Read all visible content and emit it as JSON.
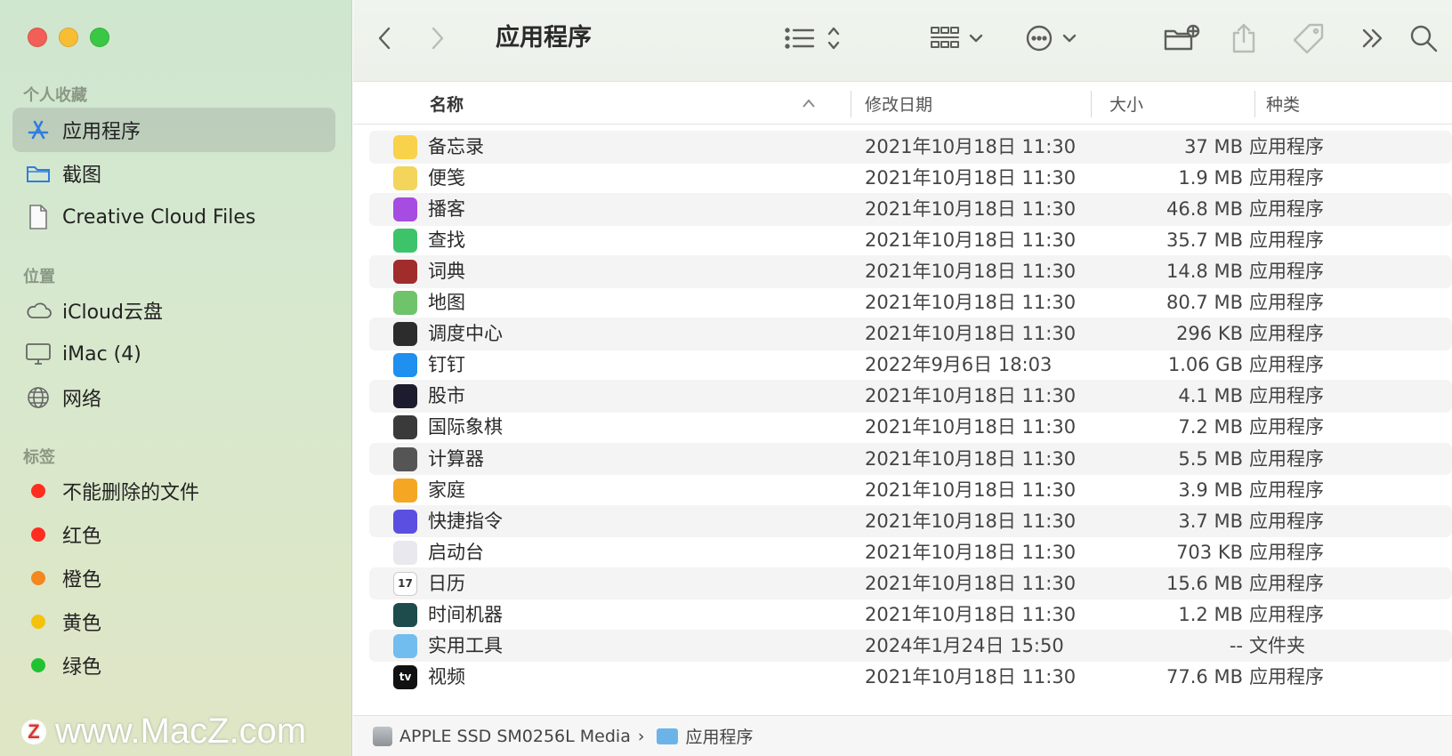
{
  "window": {
    "title": "应用程序"
  },
  "sidebar": {
    "favorites_title": "个人收藏",
    "favorites": [
      {
        "label": "应用程序",
        "icon": "apps-icon",
        "selected": true
      },
      {
        "label": "截图",
        "icon": "folder-icon"
      },
      {
        "label": "Creative Cloud Files",
        "icon": "document-icon"
      }
    ],
    "locations_title": "位置",
    "locations": [
      {
        "label": "iCloud云盘",
        "icon": "cloud-icon"
      },
      {
        "label": "iMac (4)",
        "icon": "monitor-icon"
      },
      {
        "label": "网络",
        "icon": "globe-icon"
      }
    ],
    "tags_title": "标签",
    "tags": [
      {
        "label": "不能删除的文件",
        "color": "#ff2d20"
      },
      {
        "label": "红色",
        "color": "#ff2d20"
      },
      {
        "label": "橙色",
        "color": "#f5871f"
      },
      {
        "label": "黄色",
        "color": "#f4c20d"
      },
      {
        "label": "绿色",
        "color": "#21c232"
      }
    ]
  },
  "watermark": {
    "logo": "Z",
    "text": "www.MacZ.com"
  },
  "columns": {
    "name": "名称",
    "modified": "修改日期",
    "size": "大小",
    "kind": "种类"
  },
  "files": [
    {
      "name": "备忘录",
      "date": "2021年10月18日 11:30",
      "size": "37 MB",
      "kind": "应用程序",
      "icon": "notes-icon",
      "color": "#f7d24a"
    },
    {
      "name": "便笺",
      "date": "2021年10月18日 11:30",
      "size": "1.9 MB",
      "kind": "应用程序",
      "icon": "stickies-icon",
      "color": "#f3d55b"
    },
    {
      "name": "播客",
      "date": "2021年10月18日 11:30",
      "size": "46.8 MB",
      "kind": "应用程序",
      "icon": "podcasts-icon",
      "color": "#a64ce0"
    },
    {
      "name": "查找",
      "date": "2021年10月18日 11:30",
      "size": "35.7 MB",
      "kind": "应用程序",
      "icon": "findmy-icon",
      "color": "#3dc46b"
    },
    {
      "name": "词典",
      "date": "2021年10月18日 11:30",
      "size": "14.8 MB",
      "kind": "应用程序",
      "icon": "dictionary-icon",
      "color": "#a02c2c"
    },
    {
      "name": "地图",
      "date": "2021年10月18日 11:30",
      "size": "80.7 MB",
      "kind": "应用程序",
      "icon": "maps-icon",
      "color": "#6fc36b"
    },
    {
      "name": "调度中心",
      "date": "2021年10月18日 11:30",
      "size": "296 KB",
      "kind": "应用程序",
      "icon": "mission-control-icon",
      "color": "#2c2c2c"
    },
    {
      "name": "钉钉",
      "date": "2022年9月6日 18:03",
      "size": "1.06 GB",
      "kind": "应用程序",
      "icon": "dingtalk-icon",
      "color": "#1f8ff0"
    },
    {
      "name": "股市",
      "date": "2021年10月18日 11:30",
      "size": "4.1 MB",
      "kind": "应用程序",
      "icon": "stocks-icon",
      "color": "#1c1c2e"
    },
    {
      "name": "国际象棋",
      "date": "2021年10月18日 11:30",
      "size": "7.2 MB",
      "kind": "应用程序",
      "icon": "chess-icon",
      "color": "#3a3a3a"
    },
    {
      "name": "计算器",
      "date": "2021年10月18日 11:30",
      "size": "5.5 MB",
      "kind": "应用程序",
      "icon": "calculator-icon",
      "color": "#555555"
    },
    {
      "name": "家庭",
      "date": "2021年10月18日 11:30",
      "size": "3.9 MB",
      "kind": "应用程序",
      "icon": "home-icon",
      "color": "#f5a623"
    },
    {
      "name": "快捷指令",
      "date": "2021年10月18日 11:30",
      "size": "3.7 MB",
      "kind": "应用程序",
      "icon": "shortcuts-icon",
      "color": "#5a4fe0"
    },
    {
      "name": "启动台",
      "date": "2021年10月18日 11:30",
      "size": "703 KB",
      "kind": "应用程序",
      "icon": "launchpad-icon",
      "color": "#e8e8ee"
    },
    {
      "name": "日历",
      "date": "2021年10月18日 11:30",
      "size": "15.6 MB",
      "kind": "应用程序",
      "icon": "calendar-icon",
      "color": "#ffffff",
      "glyph": "17"
    },
    {
      "name": "时间机器",
      "date": "2021年10月18日 11:30",
      "size": "1.2 MB",
      "kind": "应用程序",
      "icon": "time-machine-icon",
      "color": "#1e4b4b"
    },
    {
      "name": "实用工具",
      "date": "2024年1月24日 15:50",
      "size": "--",
      "kind": "文件夹",
      "icon": "utilities-folder-icon",
      "color": "#72bdf0"
    },
    {
      "name": "视频",
      "date": "2021年10月18日 11:30",
      "size": "77.6 MB",
      "kind": "应用程序",
      "icon": "tv-icon",
      "color": "#111111",
      "glyph": "tv"
    }
  ],
  "pathbar": {
    "disk": "APPLE SSD SM0256L Media",
    "separator": "›",
    "folder": "应用程序"
  }
}
